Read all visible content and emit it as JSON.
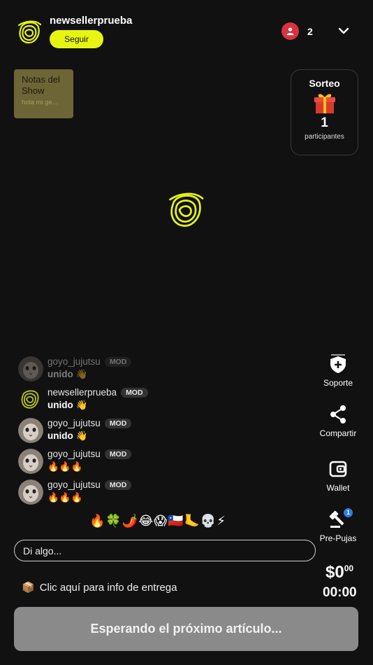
{
  "header": {
    "seller_name": "newsellerprueba",
    "follow_label": "Seguir",
    "viewer_count": "2"
  },
  "notes": {
    "title": "Notas del Show",
    "preview": "hola mi ge..."
  },
  "giveaway": {
    "title": "Sorteo",
    "count": "1",
    "label": "participantes"
  },
  "chat": {
    "messages": [
      {
        "user": "goyo_jujutsu",
        "badge": "MOD",
        "text": "unido 👋"
      },
      {
        "user": "newsellerprueba",
        "badge": "MOD",
        "text": "unido 👋"
      },
      {
        "user": "goyo_jujutsu",
        "badge": "MOD",
        "text": "unido 👋"
      },
      {
        "user": "goyo_jujutsu",
        "badge": "MOD",
        "text": "🔥🔥🔥"
      },
      {
        "user": "goyo_jujutsu",
        "badge": "MOD",
        "text": "🔥🔥🔥"
      }
    ],
    "emojis": "🔥🍀🌶️😂😱🇨🇱🦶💀⚡",
    "input_placeholder": "Di algo..."
  },
  "actions": {
    "support": "Soporte",
    "share": "Compartir",
    "wallet": "Wallet",
    "prebids": "Pre-Pujas",
    "prebids_badge": "1"
  },
  "price": {
    "main": "$0",
    "cents": "00",
    "timer": "00:00"
  },
  "delivery": {
    "icon": "📦",
    "text": "Clic aquí para info de entrega"
  },
  "cta": {
    "label": "Esperando el próximo artículo..."
  },
  "colors": {
    "accent": "#e6f512",
    "viewer_badge": "#d8333f",
    "notes_bg": "#6e6536",
    "button_disabled": "#8a8a8a"
  }
}
